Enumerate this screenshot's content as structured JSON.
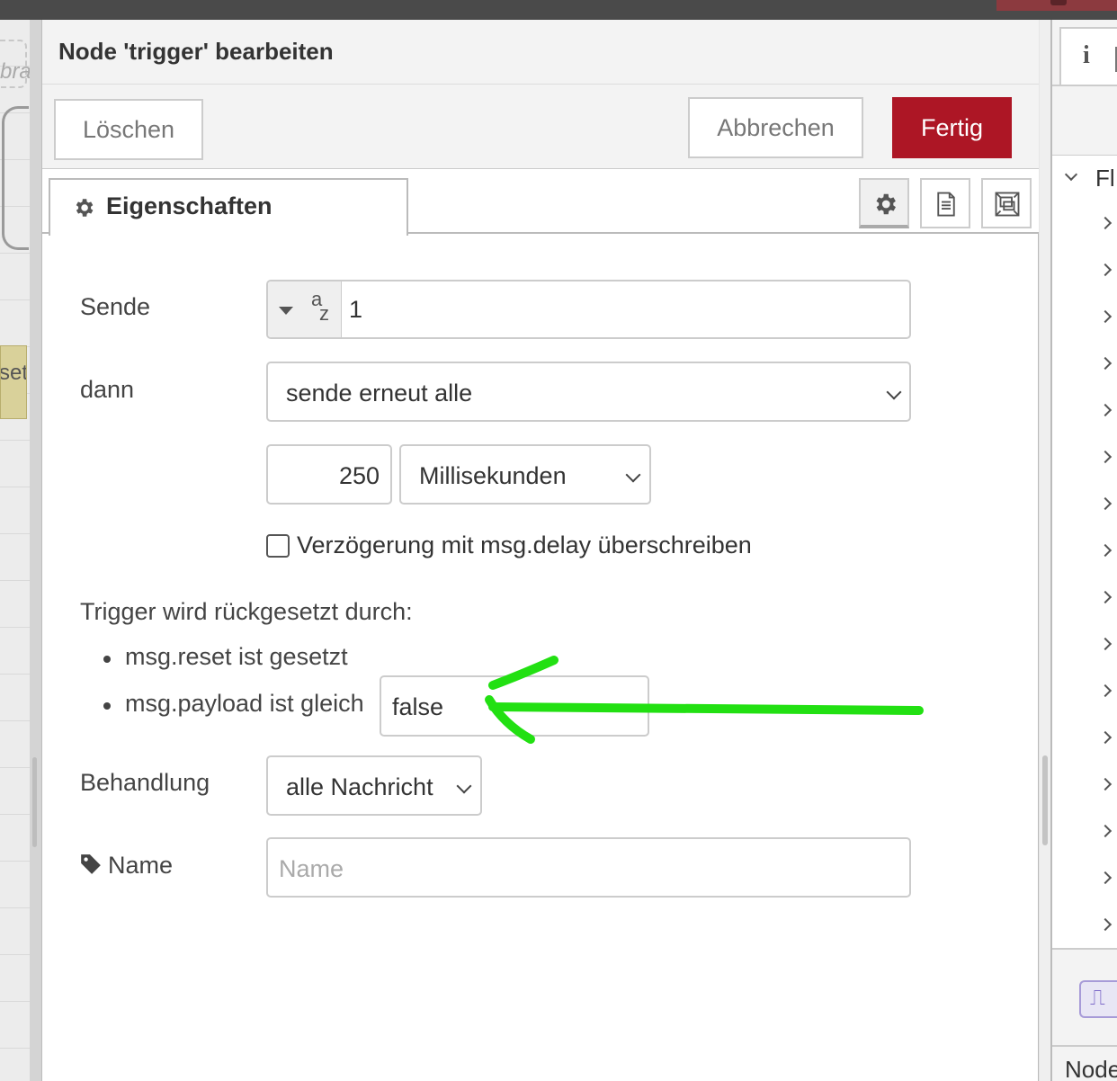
{
  "editor": {
    "title": "Node 'trigger' bearbeiten",
    "buttons": {
      "delete": "Löschen",
      "cancel": "Abbrechen",
      "done": "Fertig"
    },
    "tab": {
      "label": "Eigenschaften",
      "icon": "gear-icon"
    },
    "tab_icons": [
      "gear-icon",
      "document-icon",
      "appearance-icon"
    ]
  },
  "form": {
    "send": {
      "label": "Sende",
      "type_icon": "string-az-icon",
      "value": "1"
    },
    "then": {
      "label": "dann",
      "selected": "sende erneut alle"
    },
    "interval": {
      "value": "250",
      "unit": "Millisekunden"
    },
    "override_delay": {
      "label": "Verzögerung mit msg.delay überschreiben",
      "checked": false
    },
    "reset": {
      "heading": "Trigger wird rückgesetzt durch:",
      "items": [
        "msg.reset ist gesetzt",
        "msg.payload ist gleich"
      ],
      "payload_value": "false"
    },
    "handling": {
      "label": "Behandlung",
      "selected": "alle Nachricht"
    },
    "name": {
      "label": "Name",
      "placeholder": "Name",
      "icon": "tag-icon"
    }
  },
  "workspace": {
    "tab_text": "bra",
    "node_text": "set"
  },
  "sidebar": {
    "info_icon": "i",
    "flow_label": "Fl",
    "node_label": "Node",
    "node_icon": "⎍"
  },
  "colors": {
    "accent": "#ad1625",
    "annotation": "#22e012",
    "node_reset": "#d9d19a"
  }
}
